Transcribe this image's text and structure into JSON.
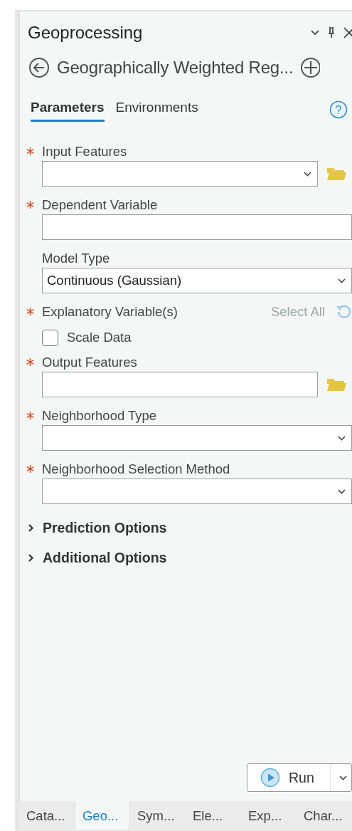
{
  "pane": {
    "title": "Geoprocessing"
  },
  "tool": {
    "title": "Geographically Weighted Reg..."
  },
  "tabs": [
    {
      "label": "Parameters",
      "selected": true
    },
    {
      "label": "Environments",
      "selected": false
    }
  ],
  "help_button": {
    "label": "?"
  },
  "parameters": [
    {
      "kind": "field",
      "required": true,
      "label": "Input Features",
      "dropdown": true,
      "browse": true
    },
    {
      "kind": "field",
      "required": true,
      "label": "Dependent Variable",
      "dropdown": false,
      "browse": false
    },
    {
      "kind": "field",
      "required": false,
      "label": "Model Type",
      "value": "Continuous (Gaussian)",
      "dropdown": true,
      "browse": false
    },
    {
      "kind": "variables",
      "required": true,
      "label": "Explanatory Variable(s)",
      "action": "Select All"
    },
    {
      "kind": "checkbox",
      "label": "Scale Data",
      "checked": false
    },
    {
      "kind": "field",
      "required": true,
      "label": "Output Features",
      "dropdown": false,
      "browse": true
    },
    {
      "kind": "field",
      "required": true,
      "label": "Neighborhood Type",
      "dropdown": true,
      "browse": false
    },
    {
      "kind": "field",
      "required": true,
      "label": "Neighborhood Selection Method",
      "dropdown": true,
      "browse": false
    }
  ],
  "groups": [
    {
      "label": "Prediction Options",
      "expanded": false
    },
    {
      "label": "Additional Options",
      "expanded": false
    }
  ],
  "run_button": {
    "label": "Run"
  },
  "dock_tabs": [
    {
      "label": "Cata...",
      "selected": false
    },
    {
      "label": "Geo...",
      "selected": true
    },
    {
      "label": "Sym...",
      "selected": false
    },
    {
      "label": "Ele...",
      "selected": false
    },
    {
      "label": "Exp...",
      "selected": false
    },
    {
      "label": "Char...",
      "selected": false
    }
  ]
}
